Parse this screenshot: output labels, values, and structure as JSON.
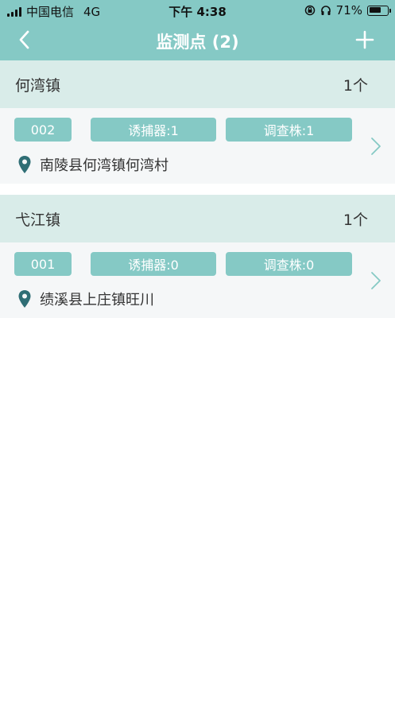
{
  "status_bar": {
    "carrier": "中国电信",
    "network": "4G",
    "time": "下午 4:38",
    "battery_text": "71%",
    "battery_level": 0.71,
    "icons": [
      "signal-bars-icon",
      "orientation-lock-icon",
      "headphones-icon",
      "battery-icon"
    ]
  },
  "nav": {
    "title": "监测点 (2)",
    "back_icon": "chevron-left-icon",
    "add_icon": "plus-icon"
  },
  "colors": {
    "header": "#85c9c5",
    "group_header": "#d9ece9",
    "item_bg": "#f5f7f8",
    "pin": "#2f6e75"
  },
  "groups": [
    {
      "town": "何湾镇",
      "count": "1个",
      "items": [
        {
          "id": "002",
          "traps": "诱捕器:1",
          "survey_trees": "调查株:1",
          "address": "南陵县何湾镇何湾村"
        }
      ]
    },
    {
      "town": "弋江镇",
      "count": "1个",
      "items": [
        {
          "id": "001",
          "traps": "诱捕器:0",
          "survey_trees": "调查株:0",
          "address": "绩溪县上庄镇旺川"
        }
      ]
    }
  ]
}
